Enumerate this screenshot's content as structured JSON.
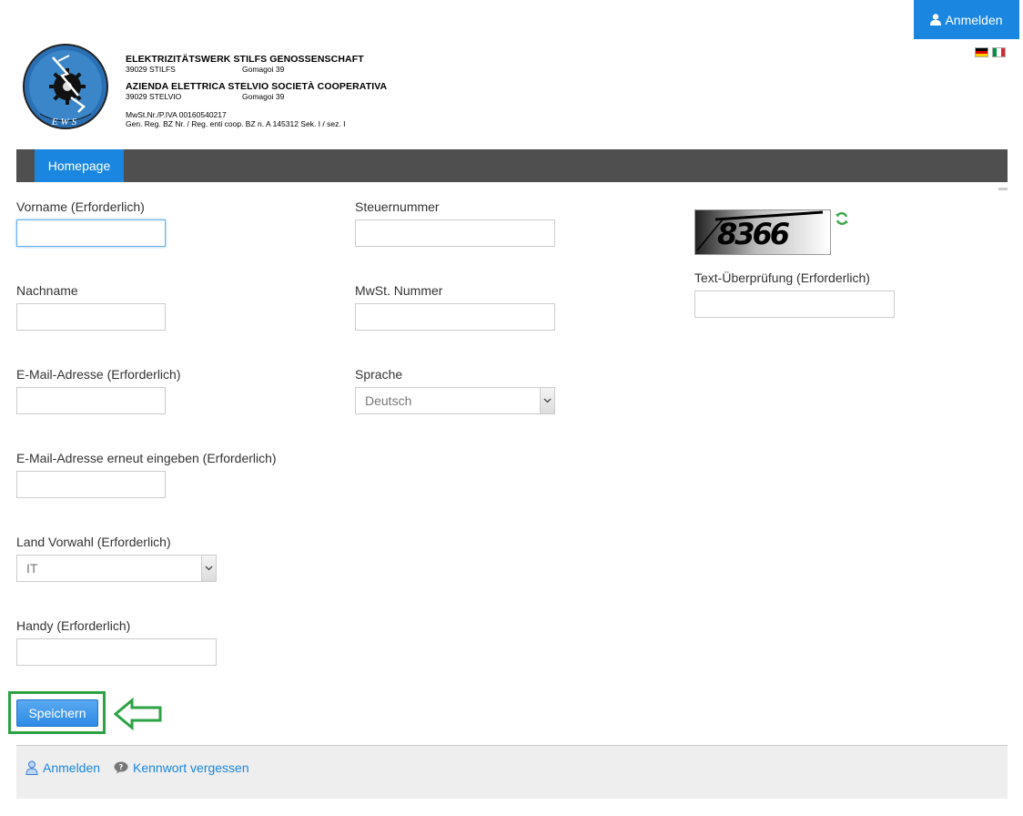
{
  "topbar": {
    "login_label": "Anmelden",
    "login_icon": "user-icon",
    "languages": [
      "Deutsch",
      "Italiano"
    ]
  },
  "letterhead": {
    "logo_text": "EWS",
    "company_de": "ELEKTRIZITÄTSWERK STILFS GENOSSENSCHAFT",
    "city_de": "39029 STILFS",
    "street_de": "Gomagoi 39",
    "company_it": "AZIENDA ELETTRICA STELVIO SOCIETÀ COOPERATIVA",
    "city_it": "39029 STELVIO",
    "street_it": "Gomagoi 39",
    "vat": "MwSt.Nr./P.IVA  00160540217",
    "register": "Gen. Reg. BZ Nr. / Reg. enti coop. BZ n. A 145312 Sek. I / sez. I"
  },
  "nav": {
    "home_label": "Homepage"
  },
  "form": {
    "firstname_label": "Vorname (Erforderlich)",
    "firstname_value": "",
    "lastname_label": "Nachname",
    "lastname_value": "",
    "email_label": "E-Mail-Adresse (Erforderlich)",
    "email_value": "",
    "email_confirm_label": "E-Mail-Adresse erneut eingeben (Erforderlich)",
    "email_confirm_value": "",
    "country_code_label": "Land Vorwahl (Erforderlich)",
    "country_code_value": "IT",
    "mobile_label": "Handy (Erforderlich)",
    "mobile_value": "",
    "taxnumber_label": "Steuernummer",
    "taxnumber_value": "",
    "vatnumber_label": "MwSt. Nummer",
    "vatnumber_value": "",
    "language_label": "Sprache",
    "language_value": "Deutsch",
    "captcha_text": "8366",
    "captcha_check_label": "Text-Überprüfung (Erforderlich)",
    "captcha_check_value": "",
    "save_label": "Speichern"
  },
  "footer": {
    "login_label": "Anmelden",
    "forgot_label": "Kennwort vergessen"
  },
  "colors": {
    "accent": "#1a86e0",
    "navbar": "#4f4f4f",
    "highlight": "#2ca244"
  }
}
